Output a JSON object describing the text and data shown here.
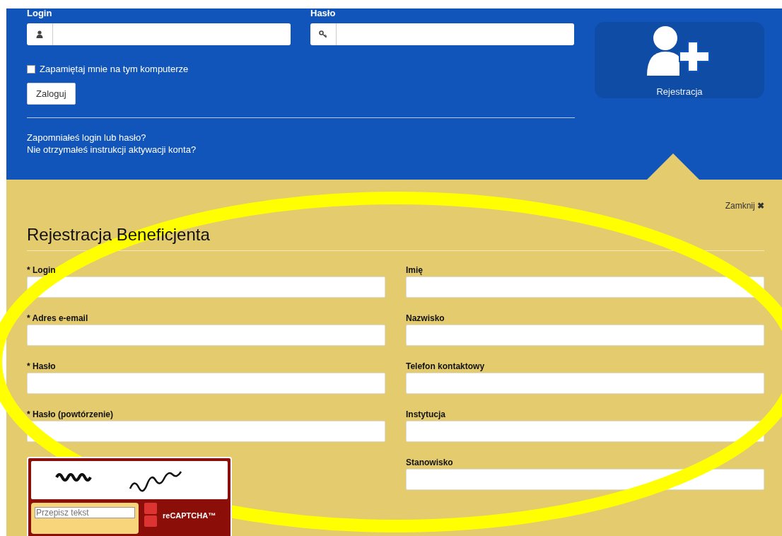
{
  "login": {
    "login_label": "Login",
    "password_label": "Hasło",
    "remember": {
      "label": "Zapamiętaj mnie na tym komputerze",
      "checked": false
    },
    "button": "Zaloguj",
    "links": [
      "Zapomniałeś login lub hasło?",
      "Nie otrzymałeś instrukcji aktywacji konta?"
    ]
  },
  "register_tile": {
    "label": "Rejestracja"
  },
  "registration": {
    "close": "Zamknij",
    "close_icon": "✖",
    "title": "Rejestracja Beneficjenta",
    "left_fields": [
      {
        "label": "* Login"
      },
      {
        "label": "* Adres e-email"
      },
      {
        "label": "* Hasło"
      },
      {
        "label": "* Hasło (powtórzenie)"
      }
    ],
    "right_fields": [
      {
        "label": "Imię"
      },
      {
        "label": "Nazwisko"
      },
      {
        "label": "Telefon kontaktowy"
      },
      {
        "label": "Instytucja"
      },
      {
        "label": "Stanowisko"
      }
    ],
    "captcha": {
      "placeholder": "Przepisz tekst",
      "logo": "reCAPTCHA™"
    }
  }
}
